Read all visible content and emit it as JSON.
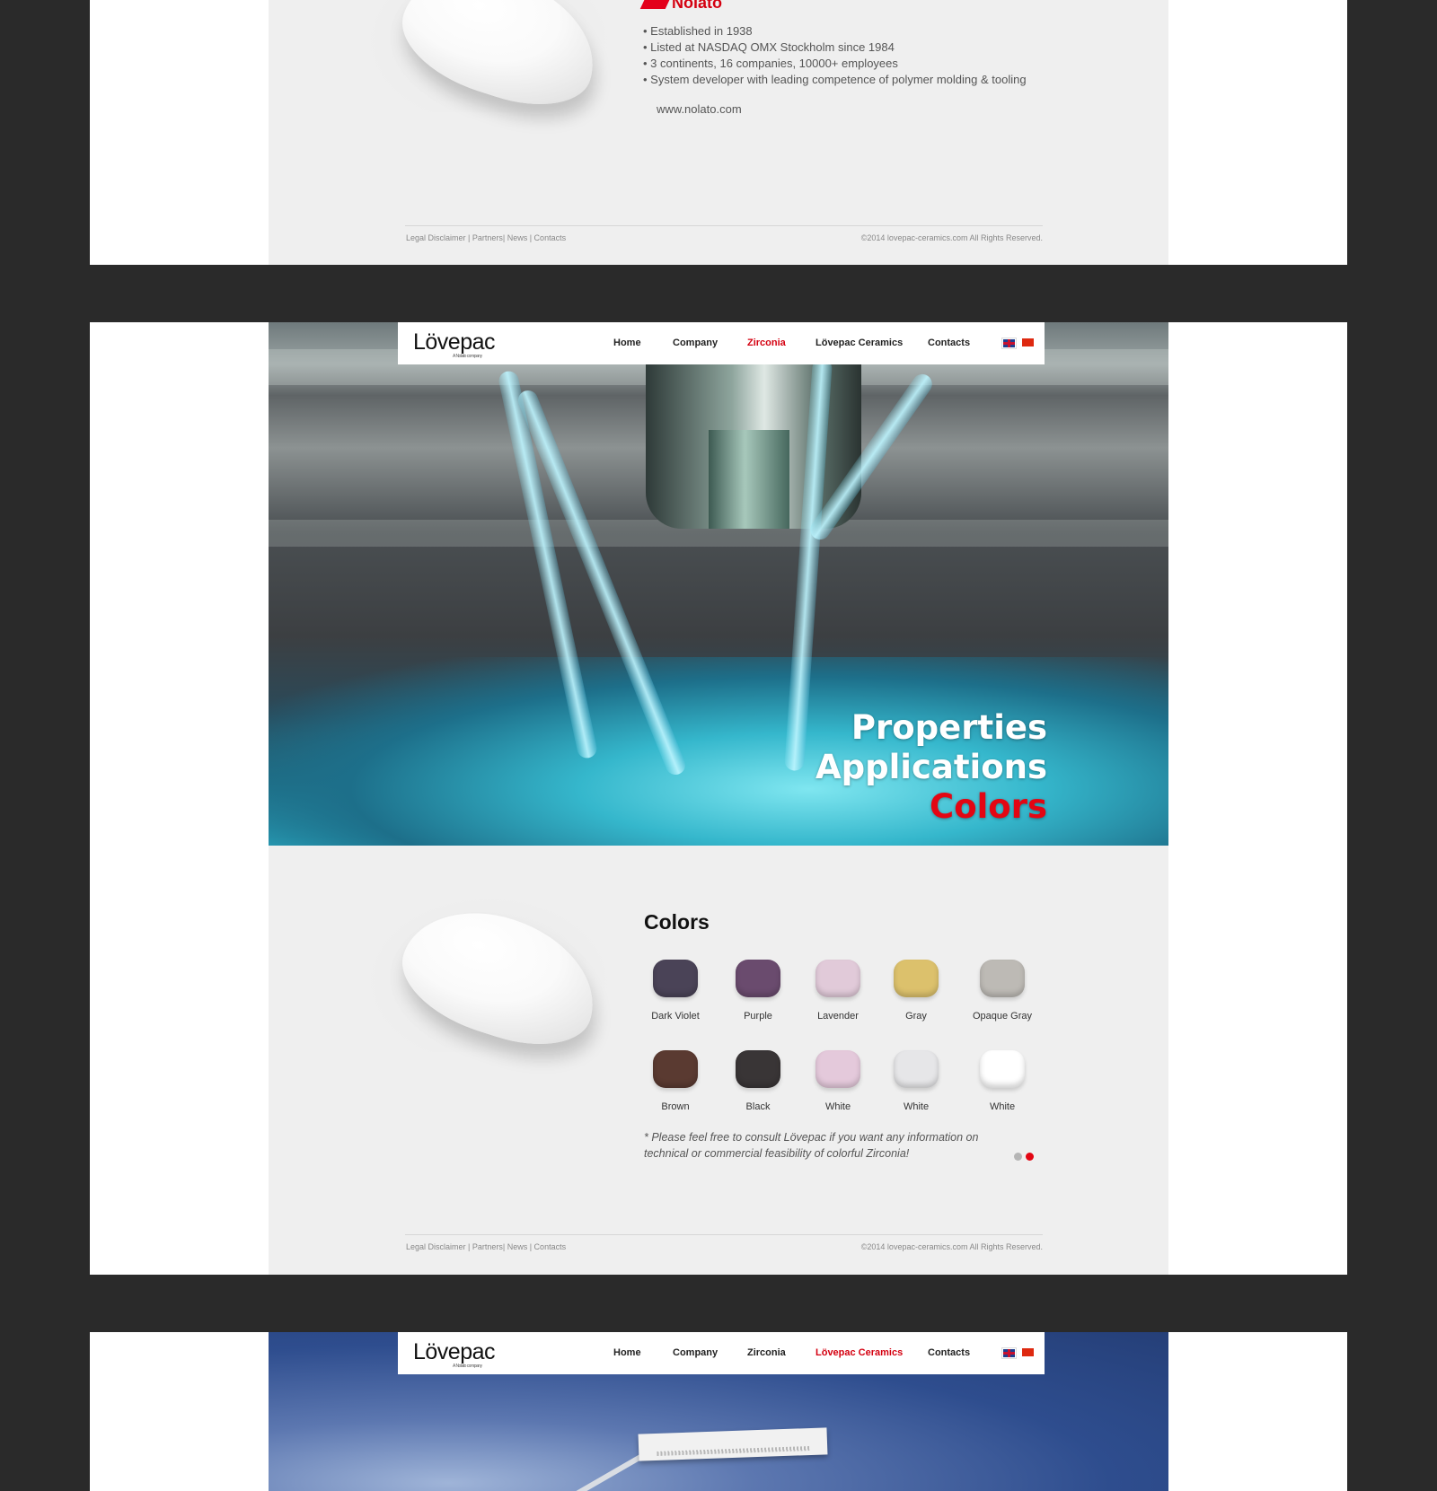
{
  "panel1": {
    "company": "Nolato",
    "facts": [
      "Established in 1938",
      "Listed at NASDAQ OMX Stockholm since 1984",
      "3 continents, 16 companies, 10000+ employees",
      "System developer with leading competence of polymer molding & tooling"
    ],
    "url": "www.nolato.com",
    "footer_links": "Legal Disclaimer | Partners| News | Contacts",
    "copyright": "©2014 lovepac-ceramics.com All Rights Reserved."
  },
  "panel2": {
    "logo": "Lövepac",
    "logo_tagline": "A Nolato company",
    "nav": [
      "Home",
      "Company",
      "Zirconia",
      "Lövepac Ceramics",
      "Contacts"
    ],
    "nav_active": "Zirconia",
    "hero_menu": [
      "Properties",
      "Applications",
      "Colors"
    ],
    "hero_active": "Colors",
    "section_title": "Colors",
    "swatches": [
      {
        "label": "Dark Violet",
        "color": "#4a4357"
      },
      {
        "label": "Purple",
        "color": "#6a4b6e"
      },
      {
        "label": "Lavender",
        "color": "#e1cad9"
      },
      {
        "label": "Gray",
        "color": "#dcc16c"
      },
      {
        "label": "Opaque Gray",
        "color": "#bdbab5"
      },
      {
        "label": "Brown",
        "color": "#5a3a31"
      },
      {
        "label": "Black",
        "color": "#393536"
      },
      {
        "label": "White",
        "color": "#e4c9db"
      },
      {
        "label": "White",
        "color": "#e6e6e8"
      },
      {
        "label": "White",
        "color": "#ffffff"
      }
    ],
    "note": "* Please feel free to consult Lövepac if you want any information on technical or commercial feasibility of colorful Zirconia!",
    "pager": {
      "count": 2,
      "active": 2,
      "active_color": "#e30613",
      "inactive_color": "#b5b5b5"
    },
    "footer_links": "Legal Disclaimer | Partners| News | Contacts",
    "copyright": "©2014 lovepac-ceramics.com All Rights Reserved."
  },
  "panel3": {
    "logo": "Lövepac",
    "logo_tagline": "A Nolato company",
    "nav": [
      "Home",
      "Company",
      "Zirconia",
      "Lövepac Ceramics",
      "Contacts"
    ],
    "nav_active": "Lövepac Ceramics"
  },
  "colors": {
    "page_bg": "#2a2a2a",
    "accent": "#d40010",
    "content_bg": "#efefef"
  }
}
